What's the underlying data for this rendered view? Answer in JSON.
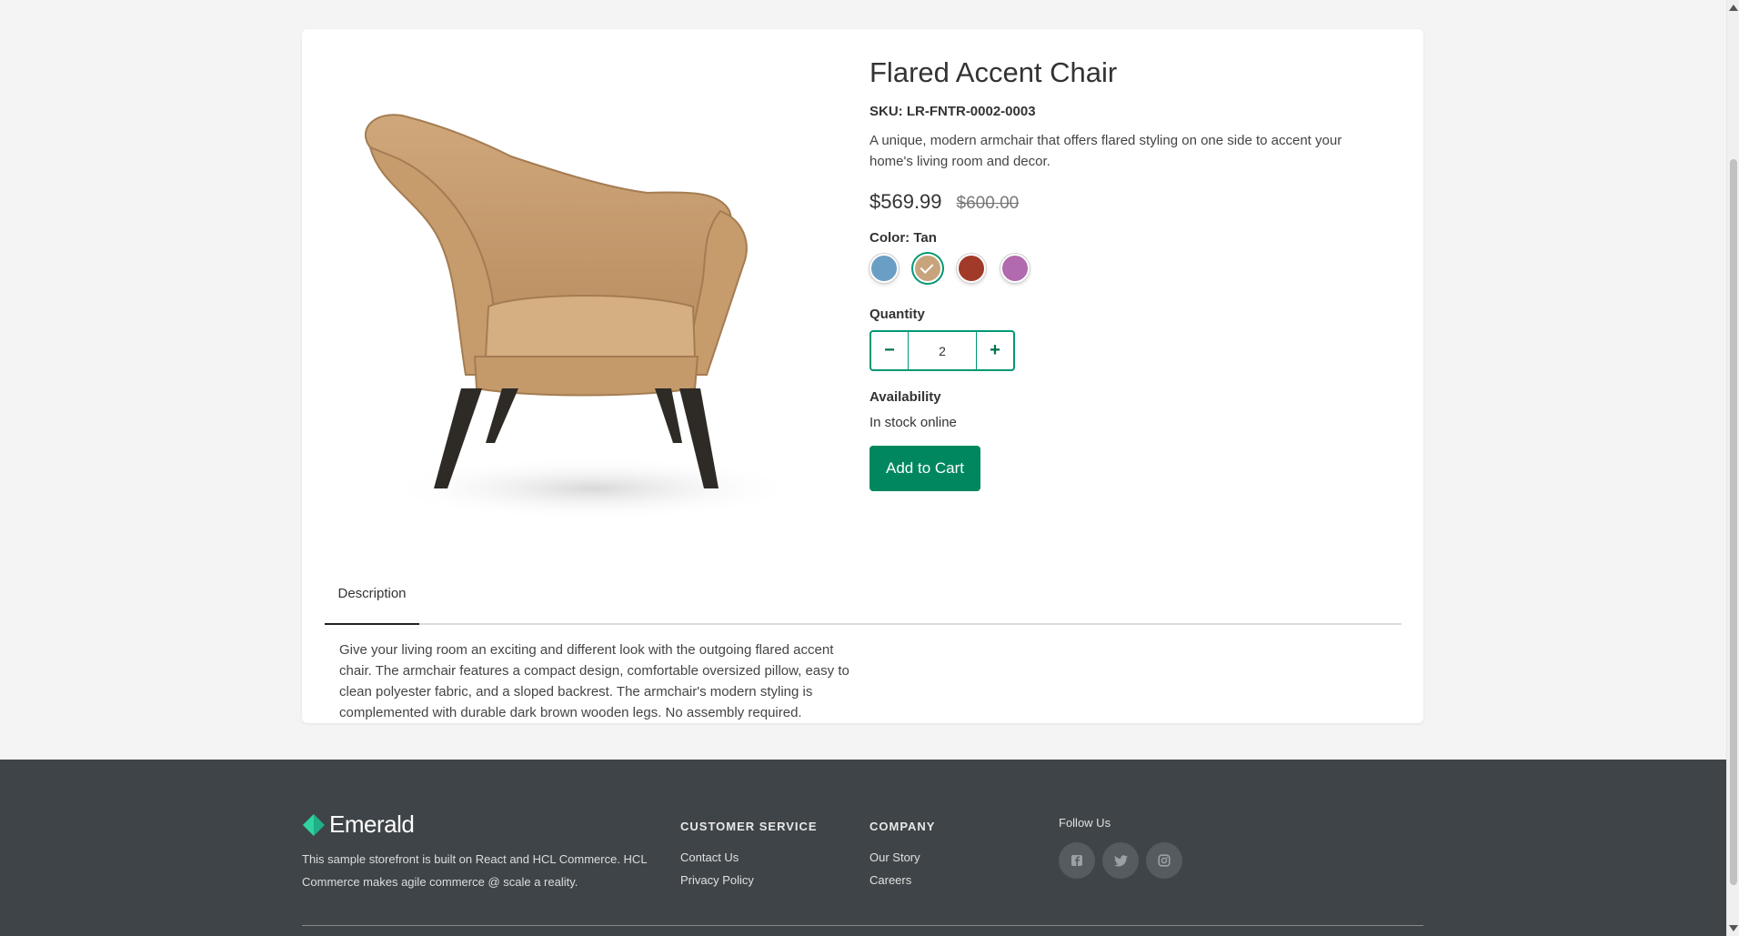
{
  "product": {
    "title": "Flared Accent Chair",
    "sku": "SKU: LR-FNTR-0002-0003",
    "short_description": "A unique, modern armchair that offers flared styling on one side to accent your home's living room and decor.",
    "price": "$569.99",
    "list_price": "$600.00",
    "color_label": "Color: Tan",
    "colors": [
      {
        "name": "Blue",
        "hex": "#6a9ec5",
        "selected": false
      },
      {
        "name": "Tan",
        "hex": "#c8a47c",
        "selected": true
      },
      {
        "name": "Red",
        "hex": "#a23a2a",
        "selected": false
      },
      {
        "name": "Purple",
        "hex": "#b06aad",
        "selected": false
      }
    ],
    "quantity_label": "Quantity",
    "quantity_value": "2",
    "decrement_symbol": "−",
    "increment_symbol": "+",
    "availability_label": "Availability",
    "availability_value": "In stock online",
    "add_to_cart_label": "Add to Cart"
  },
  "tabs": [
    {
      "label": "Description",
      "active": true
    }
  ],
  "long_description": "Give your living room an exciting and different look with the outgoing flared accent chair. The armchair features a compact design, comfortable oversized pillow, easy to clean polyester fabric, and a sloped backrest. The armchair's modern styling is complemented with durable dark brown wooden legs. No assembly required.",
  "footer": {
    "brand_name": "Emerald",
    "brand_description": "This sample storefront is built on React and HCL Commerce. HCL Commerce makes agile commerce @ scale a reality.",
    "customer_service": {
      "heading": "CUSTOMER SERVICE",
      "links": [
        "Contact Us",
        "Privacy Policy"
      ]
    },
    "company": {
      "heading": "COMPANY",
      "links": [
        "Our Story",
        "Careers"
      ]
    },
    "follow_label": "Follow Us",
    "socials": [
      "facebook-icon",
      "twitter-icon",
      "instagram-icon"
    ]
  },
  "colors": {
    "accent": "#009874",
    "button": "#00875f",
    "footer_bg": "#3f4448"
  }
}
